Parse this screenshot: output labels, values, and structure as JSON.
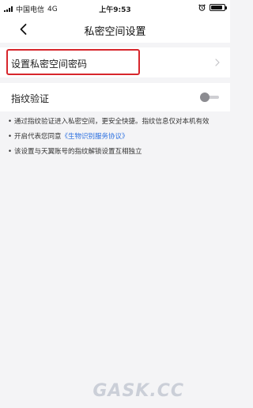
{
  "statusbar": {
    "carrier": "中国电信",
    "network": "4G",
    "time": "上午9:53",
    "battery_level": 0.9
  },
  "nav": {
    "title": "私密空间设置"
  },
  "password_row": {
    "label": "设置私密空间密码"
  },
  "fingerprint_row": {
    "label": "指纹验证",
    "enabled": false
  },
  "notes": {
    "n1": "通过指纹验证进入私密空间，更安全快捷。指纹信息仅对本机有效",
    "n2_prefix": "开启代表您同意",
    "n2_link": "《生物识别服务协议》",
    "n3": "该设置与天翼账号的指纹解锁设置互相独立"
  },
  "watermark": {
    "text": "GASK.CC"
  },
  "colors": {
    "highlight": "#d7262c",
    "link": "#2a6fe0",
    "background": "#f4f4f6"
  }
}
